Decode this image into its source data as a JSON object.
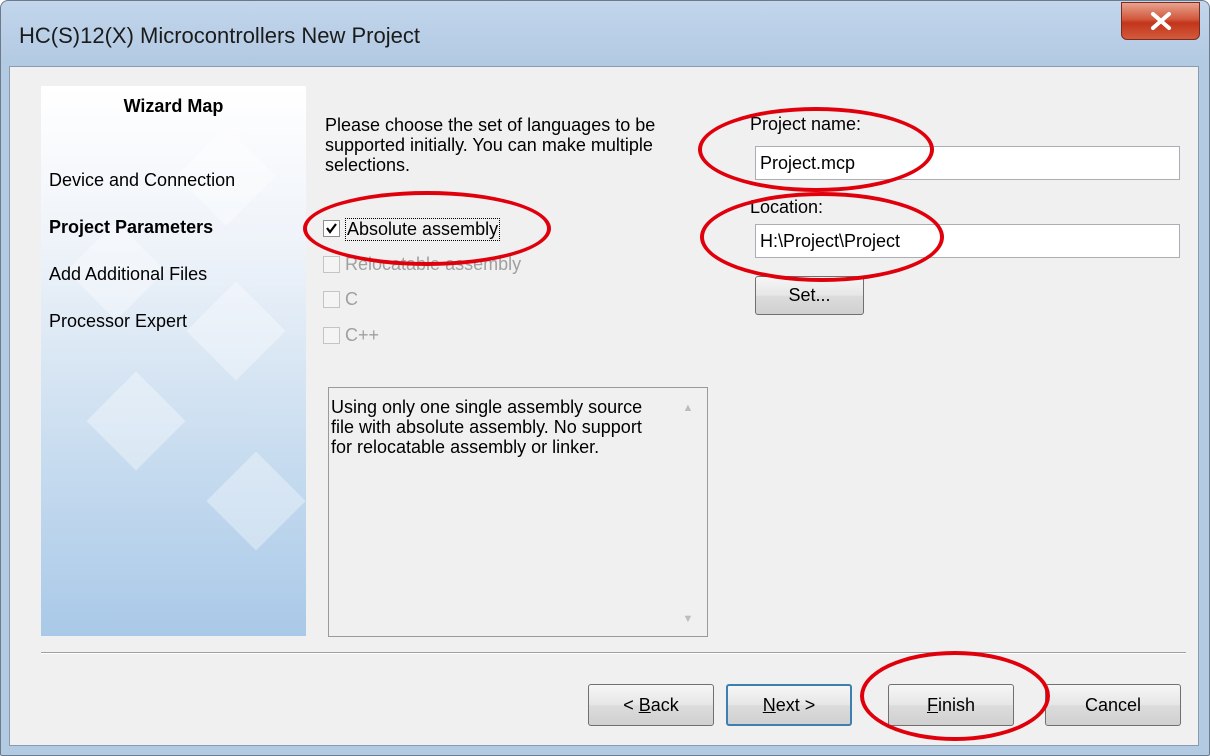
{
  "window": {
    "title": "HC(S)12(X) Microcontrollers New Project"
  },
  "wizard_map": {
    "title": "Wizard Map",
    "items": [
      {
        "label": "Device and Connection",
        "active": false
      },
      {
        "label": "Project Parameters",
        "active": true
      },
      {
        "label": "Add Additional Files",
        "active": false
      },
      {
        "label": "Processor Expert",
        "active": false
      }
    ]
  },
  "languages": {
    "prompt_line1": "Please choose the set of languages to be",
    "prompt_line2": "supported initially. You can make multiple",
    "prompt_line3": "selections.",
    "options": [
      {
        "label": "Absolute assembly",
        "checked": true,
        "enabled": true
      },
      {
        "label": "Relocatable assembly",
        "checked": false,
        "enabled": false
      },
      {
        "label": "C",
        "checked": false,
        "enabled": false
      },
      {
        "label": "C++",
        "checked": false,
        "enabled": false
      }
    ],
    "description": "Using only one single assembly source\nfile with absolute assembly. No support\nfor relocatable assembly or linker."
  },
  "project": {
    "name_label": "Project name:",
    "name_value": "Project.mcp",
    "location_label": "Location:",
    "location_value": "H:\\Project\\Project",
    "set_button": "Set..."
  },
  "buttons": {
    "back_prefix": "< ",
    "back_mnemonic": "B",
    "back_rest": "ack",
    "next_mnemonic": "N",
    "next_rest": "ext >",
    "finish_mnemonic": "F",
    "finish_rest": "inish",
    "cancel": "Cancel"
  },
  "colors": {
    "highlight_circle": "#e0000c",
    "close_button": "#c2351b"
  },
  "icons": {
    "close": "close-x-icon",
    "check": "checkmark-icon"
  }
}
